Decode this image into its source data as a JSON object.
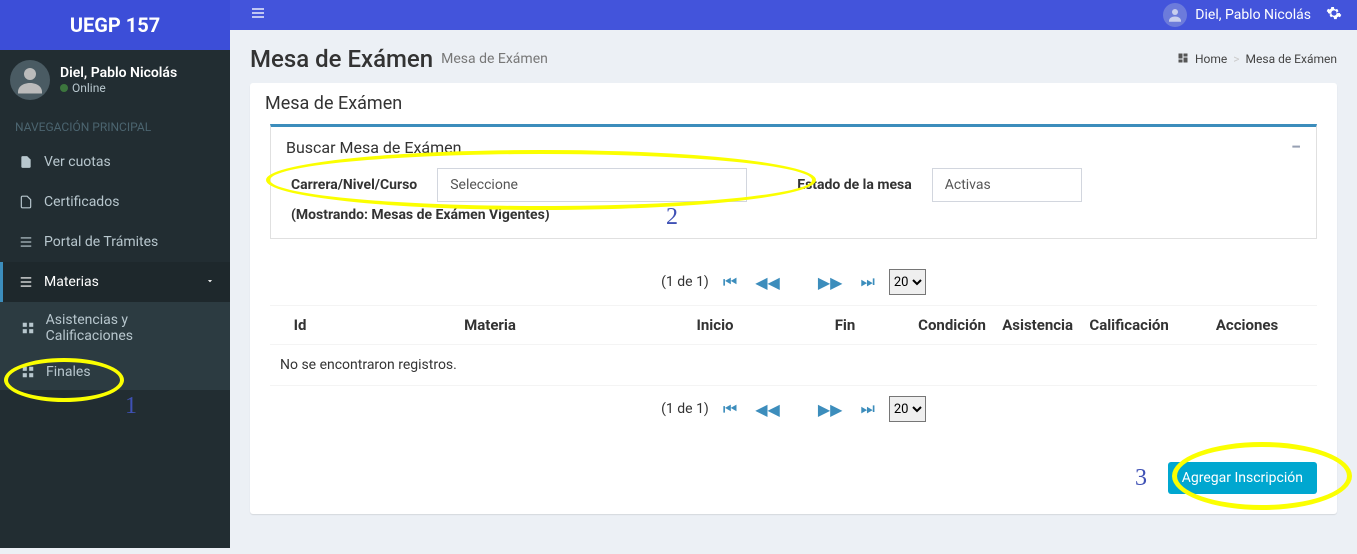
{
  "brand": "UEGP 157",
  "user": {
    "name": "Diel, Pablo Nicolás",
    "status": "Online"
  },
  "nav": {
    "header": "NAVEGACIÓN PRINCIPAL",
    "items": [
      {
        "label": "Ver cuotas"
      },
      {
        "label": "Certificados"
      },
      {
        "label": "Portal de Trámites"
      },
      {
        "label": "Materias"
      }
    ],
    "sub": [
      {
        "label": "Asistencias y Calificaciones"
      },
      {
        "label": "Finales"
      }
    ]
  },
  "page": {
    "title": "Mesa de Exámen",
    "subtitle": "Mesa de Exámen",
    "crumb_home": "Home",
    "crumb_current": "Mesa de Exámen"
  },
  "panel": {
    "title": "Mesa de Exámen",
    "search_title": "Buscar Mesa de Exámen",
    "field_carrera_label": "Carrera/Nivel/Curso",
    "field_carrera_value": "Seleccione",
    "field_estado_label": "Estado de la mesa",
    "field_estado_value": "Activas",
    "hint": "(Mostrando: Mesas de Exámen Vigentes)"
  },
  "table": {
    "page_info": "(1 de 1)",
    "page_size": "20",
    "headers": [
      "Id",
      "Materia",
      "Inicio",
      "Fin",
      "Condición",
      "Asistencia",
      "Calificación",
      "Acciones"
    ],
    "empty": "No se encontraron registros."
  },
  "actions": {
    "add": "Agregar Inscripción"
  },
  "annotations": {
    "a1": "1",
    "a2": "2",
    "a3": "3"
  }
}
